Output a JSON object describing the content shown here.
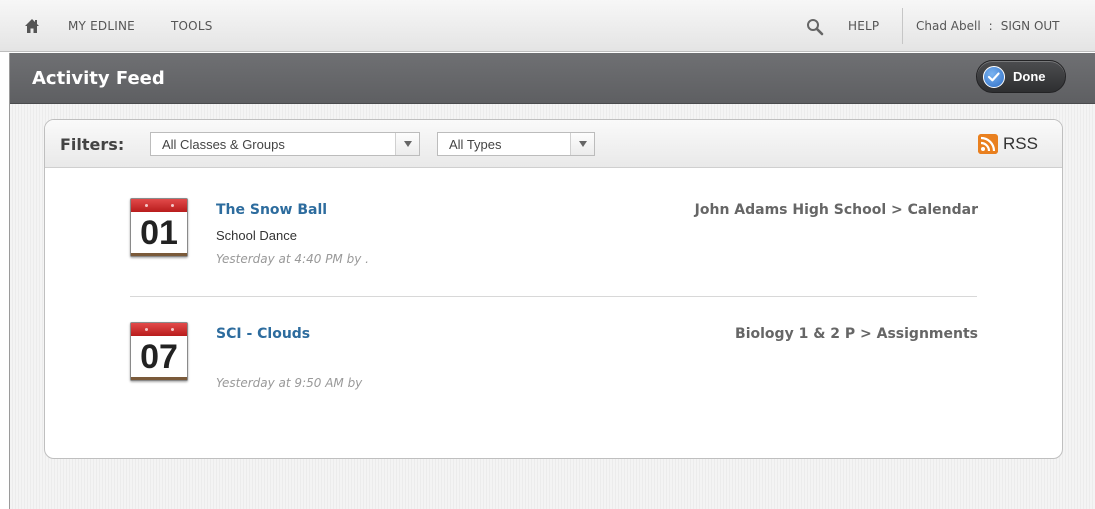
{
  "nav": {
    "my_edline": "MY EDLINE",
    "tools": "TOOLS",
    "help": "HELP",
    "user_name": "Chad Abell",
    "separator": ":",
    "sign_out": "SIGN OUT"
  },
  "header": {
    "title": "Activity Feed",
    "done_label": "Done"
  },
  "filters": {
    "label": "Filters:",
    "class_select": "All Classes & Groups",
    "type_select": "All Types",
    "rss_label": "RSS"
  },
  "feed": [
    {
      "day": "01",
      "title": "The Snow Ball",
      "subtitle": "School Dance",
      "time": "Yesterday at 4:40 PM by .",
      "path": "John Adams High School > Calendar"
    },
    {
      "day": "07",
      "title": "SCI - Clouds",
      "subtitle": "",
      "time": "Yesterday at 9:50 AM by",
      "path": "Biology 1 & 2 P > Assignments"
    }
  ],
  "colors": {
    "accent_link": "#2d6c9e",
    "title_bar": "#67686b",
    "rss": "#e9801f",
    "calendar_red": "#c62828"
  }
}
